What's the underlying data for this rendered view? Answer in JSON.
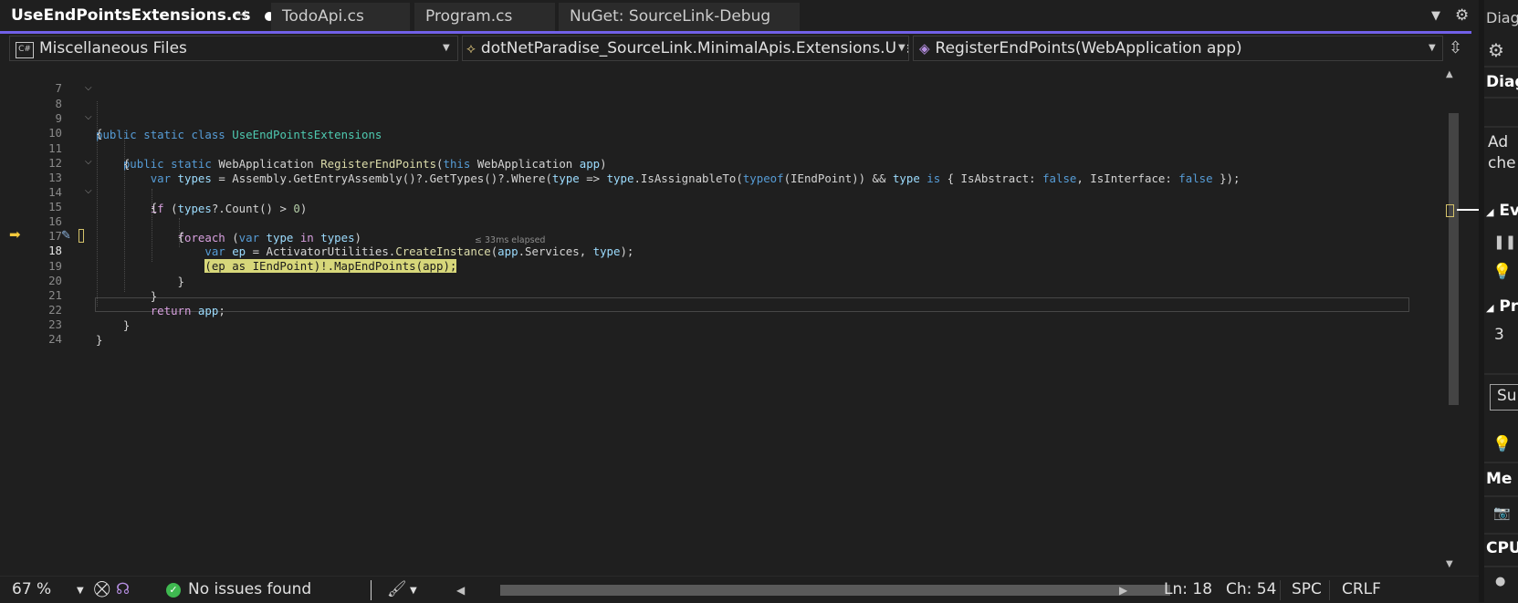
{
  "tabs": [
    {
      "label": "UseEndPointsExtensions.cs",
      "active": true
    },
    {
      "label": "TodoApi.cs",
      "active": false
    },
    {
      "label": "Program.cs",
      "active": false
    },
    {
      "label": "NuGet: SourceLink-Debug",
      "active": false
    }
  ],
  "nav": {
    "project": "Miscellaneous Files",
    "project_badge": "C#",
    "type": "dotNetParadise_SourceLink.MinimalApis.Extensions.UseEndPointsExtensions",
    "member": "RegisterEndPoints(WebApplication app)"
  },
  "editor": {
    "line_numbers": [
      "7",
      "8",
      "9",
      "10",
      "11",
      "12",
      "13",
      "14",
      "15",
      "16",
      "17",
      "18",
      "19",
      "20",
      "21",
      "22",
      "23",
      "24"
    ],
    "current_line": "18",
    "perf_tip": "≤ 33ms elapsed",
    "code": {
      "l8": [
        "public",
        "static",
        "class",
        "UseEndPointsExtensions"
      ],
      "l9": "{",
      "l10": [
        "public",
        "static",
        "WebApplication",
        "RegisterEndPoints",
        "(",
        "this",
        "WebApplication",
        "app",
        ")"
      ],
      "l11": "{",
      "l12": [
        "var",
        "types",
        " = Assembly.",
        "GetEntryAssembly",
        "()?.",
        "GetTypes",
        "()?.",
        "Where",
        "(",
        "type",
        " => ",
        "type",
        ".",
        "IsAssignableTo",
        "(",
        "typeof",
        "(IEndPoint)) && ",
        "type",
        " ",
        "is",
        " { IsAbstract: ",
        "false",
        ", IsInterface: ",
        "false",
        " });"
      ],
      "l13": [
        "if",
        " (",
        "types",
        "?.",
        "Count",
        "() > ",
        "0",
        ")"
      ],
      "l14": "{",
      "l15": [
        "foreach",
        " (",
        "var",
        " ",
        "type",
        " ",
        "in",
        " ",
        "types",
        ")"
      ],
      "l16": "{",
      "l17": [
        "var",
        " ",
        "ep",
        " = ActivatorUtilities.",
        "CreateInstance",
        "(",
        "app",
        ".Services, ",
        "type",
        ");"
      ],
      "l18": "(ep as IEndPoint)!.MapEndPoints(app);",
      "l19": "}",
      "l20": "}",
      "l21": [
        "return",
        " ",
        "app",
        ";"
      ],
      "l22": "}",
      "l23": "}"
    }
  },
  "status": {
    "zoom": "67 %",
    "issues": "No issues found",
    "ln": "Ln: 18",
    "ch": "Ch: 54",
    "spc": "SPC",
    "eol": "CRLF"
  },
  "side_panel": {
    "title": "Diag",
    "heading1": "Diag",
    "text1": "Ad",
    "text2": "che",
    "section_events": "Ev",
    "section_process": "Pr",
    "process_value": "3",
    "tab_summary": "Sur",
    "section_memory": "Me",
    "section_cpu": "CPU"
  },
  "colors": {
    "accent": "#7160e8",
    "keyword": "#569cd6",
    "control": "#d8a0df",
    "type": "#4ec9b0",
    "method": "#dcdcaa",
    "variable": "#9cdcfe",
    "number": "#b5cea8",
    "statement_highlight": "#d7d77a",
    "ok": "#3fb950"
  },
  "icons": [
    "pin-icon",
    "unsaved-dot-icon",
    "tab-overflow-icon",
    "settings-icon",
    "csharp-project-icon",
    "namespace-icon",
    "method-icon",
    "split-editor-icon",
    "execution-arrow-icon",
    "breakpoint-settings-icon",
    "check-circle-icon",
    "brush-icon"
  ]
}
